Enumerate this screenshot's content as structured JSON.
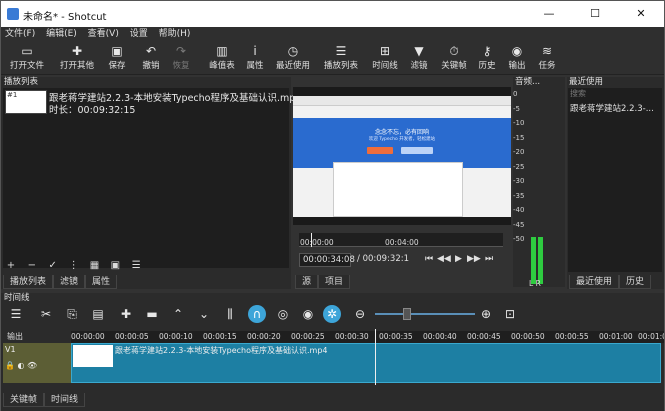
{
  "window": {
    "title": "未命名* - Shotcut",
    "controls": {
      "minimize": "—",
      "maximize": "☐",
      "close": "✕"
    }
  },
  "menu": [
    "文件(F)",
    "编辑(E)",
    "查看(V)",
    "设置",
    "帮助(H)"
  ],
  "toolbar": [
    {
      "label": "打开文件",
      "icon": "folder-open-icon",
      "glyph": "▭",
      "enabled": true
    },
    {
      "label": "打开其他",
      "icon": "open-other-icon",
      "glyph": "✚",
      "enabled": true
    },
    {
      "label": "保存",
      "icon": "save-icon",
      "glyph": "▣",
      "enabled": true
    },
    {
      "label": "撤销",
      "icon": "undo-icon",
      "glyph": "↶",
      "enabled": true
    },
    {
      "label": "恢复",
      "icon": "redo-icon",
      "glyph": "↷",
      "enabled": false
    },
    {
      "label": "峰值表",
      "icon": "peak-meter-icon",
      "glyph": "▥",
      "enabled": true
    },
    {
      "label": "属性",
      "icon": "info-icon",
      "glyph": "i",
      "enabled": true
    },
    {
      "label": "最近使用",
      "icon": "clock-icon",
      "glyph": "◷",
      "enabled": true
    },
    {
      "label": "播放列表",
      "icon": "playlist-icon",
      "glyph": "☰",
      "enabled": true
    },
    {
      "label": "时间线",
      "icon": "timeline-icon",
      "glyph": "⊞",
      "enabled": true
    },
    {
      "label": "滤镜",
      "icon": "filter-icon",
      "glyph": "▼",
      "enabled": true
    },
    {
      "label": "关键帧",
      "icon": "keyframe-icon",
      "glyph": "⏱",
      "enabled": true
    },
    {
      "label": "历史",
      "icon": "history-icon",
      "glyph": "⚷",
      "enabled": true
    },
    {
      "label": "输出",
      "icon": "export-icon",
      "glyph": "◉",
      "enabled": true
    },
    {
      "label": "任务",
      "icon": "jobs-icon",
      "glyph": "≋",
      "enabled": true
    }
  ],
  "playlist": {
    "header": "播放列表",
    "item": {
      "number": "#1",
      "name": "跟老蒋学建站2.2.3-本地安装Typecho程序及基础认识.mp4",
      "duration": "时长：00:09:32:15"
    },
    "tools": [
      "+",
      "−",
      "✓",
      "⋮",
      "▦",
      "▣",
      "☰"
    ],
    "tabs": [
      "播放列表",
      "滤镜",
      "属性"
    ]
  },
  "viewer": {
    "video_headline": "念念不忘，必有回响",
    "video_sub": "欢迎 Typecho 开发者，轻松建站",
    "ruler": [
      "00:00:00",
      "00:04:00"
    ],
    "current_time": "00:00:34:08",
    "total_time": "/ 00:09:32:1",
    "controls": [
      "⏮",
      "◀◀",
      "▶",
      "▶▶",
      "⏭"
    ],
    "tabs": [
      "源",
      "项目"
    ]
  },
  "audio": {
    "header": "音频...",
    "scale": [
      "0",
      "-5",
      "-10",
      "-15",
      "-20",
      "-25",
      "-30",
      "-35",
      "-40",
      "-45",
      "-50"
    ],
    "lr": "L R"
  },
  "recent": {
    "header": "最近使用",
    "search_placeholder": "搜索",
    "item": "跟老蒋学建站2.2.3-...",
    "tabs": [
      "最近使用",
      "历史"
    ]
  },
  "timeline": {
    "header": "时间线",
    "output_label": "输出",
    "track": {
      "name": "V1",
      "icons": "🔒 ◐ 👁"
    },
    "ruler": [
      "00:00:00",
      "00:00:05",
      "00:00:10",
      "00:00:15",
      "00:00:20",
      "00:00:25",
      "00:00:30",
      "00:00:35",
      "00:00:40",
      "00:00:45",
      "00:00:50",
      "00:00:55",
      "00:01:00",
      "00:01:05"
    ],
    "clip_name": "跟老蒋学建站2.2.3-本地安装Typecho程序及基础认识.mp4",
    "tabs": [
      "关键帧",
      "时间线"
    ]
  }
}
